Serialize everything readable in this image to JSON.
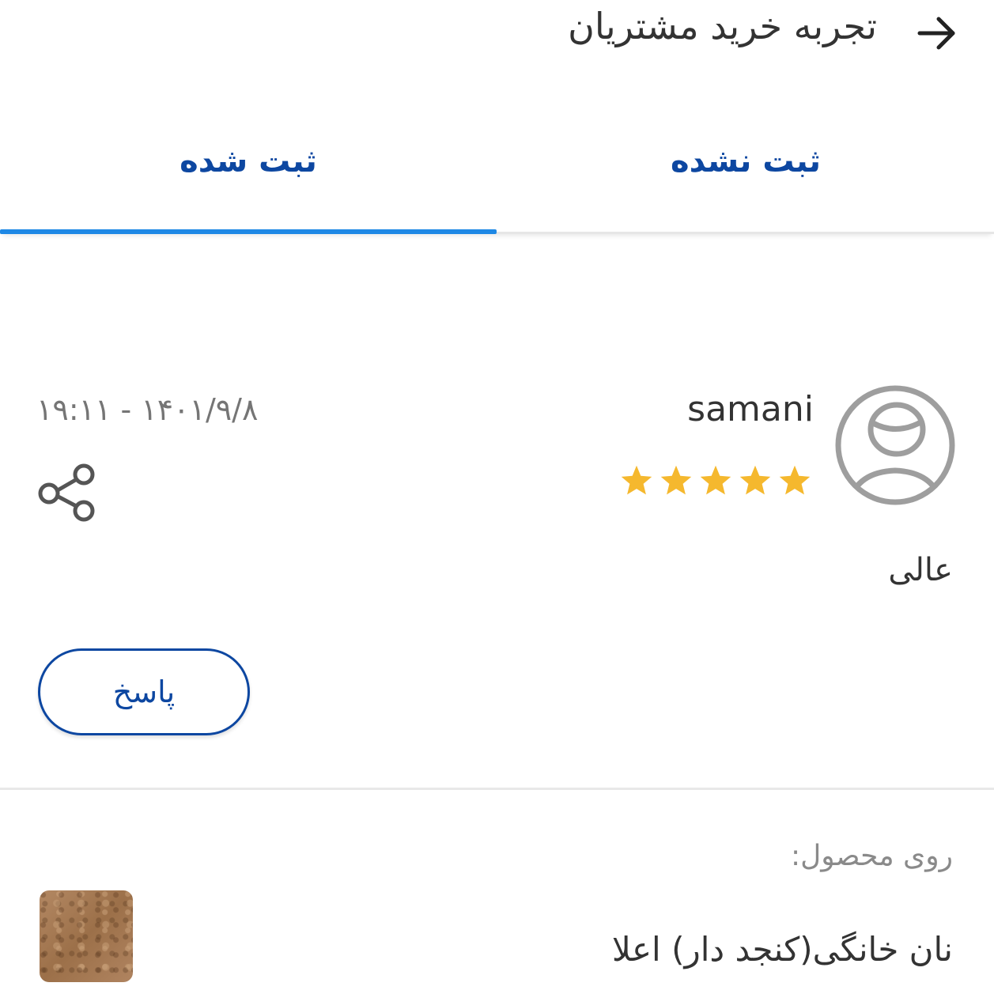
{
  "header": {
    "title": "تجربه خرید مشتریان",
    "back_icon": "arrow-right-icon"
  },
  "tabs": [
    {
      "label": "ثبت شده",
      "active": true
    },
    {
      "label": "ثبت نشده",
      "active": false
    }
  ],
  "colors": {
    "accent": "#0d47a1",
    "tab_indicator": "#1e88e5",
    "star": "#f5b82e",
    "muted": "#757575"
  },
  "review": {
    "username": "samani",
    "rating": 5,
    "rating_max": 5,
    "datetime": "۱۹:۱۱ - ۱۴۰۱/۹/۸",
    "comment": "عالی",
    "reply_label": "پاسخ",
    "avatar_icon": "user-avatar-icon",
    "share_icon": "share-icon"
  },
  "product": {
    "label": "روی محصول:",
    "name": "نان خانگی(کنجد دار) اعلا"
  }
}
